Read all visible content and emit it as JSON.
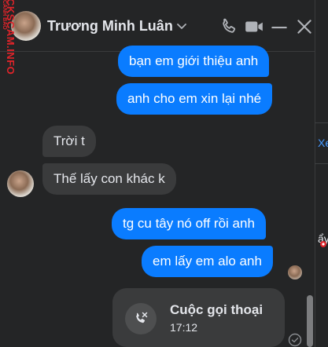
{
  "header": {
    "contact_name": "Trương Minh Luân",
    "avatar_icon": "contact-avatar",
    "actions": [
      "chevron-down-icon",
      "phone-icon",
      "video-icon",
      "minimize-icon",
      "close-icon"
    ]
  },
  "watermark": {
    "text": "CKSCAM.INFO",
    "small_text": "CẢNH BÁO"
  },
  "messages": [
    {
      "direction": "out",
      "text": "bạn em giới thiệu anh"
    },
    {
      "direction": "out",
      "text": "anh cho em xin lại nhé"
    },
    {
      "direction": "in",
      "text": "Trời t"
    },
    {
      "direction": "in",
      "text": "Thế lấy con khác k"
    },
    {
      "direction": "out",
      "text": "tg cu tây nó off rồi anh"
    },
    {
      "direction": "out",
      "text": "em lấy em alo anh"
    }
  ],
  "call": {
    "title": "Cuộc gọi thoại",
    "time": "17:12",
    "icon": "missed-call-icon"
  },
  "right_edge": {
    "text_1": "Xe",
    "text_2": "ẩy"
  },
  "colors": {
    "background": "#242526",
    "outgoing_bubble": "#0a7cff",
    "incoming_bubble": "#3a3b3c",
    "watermark": "#e0242a"
  }
}
